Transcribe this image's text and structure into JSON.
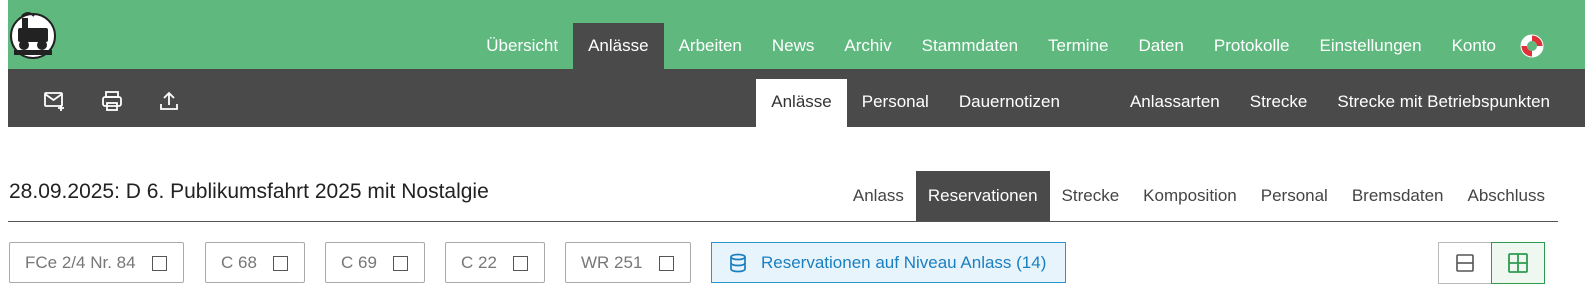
{
  "topnav": {
    "items": [
      "Übersicht",
      "Anlässe",
      "Arbeiten",
      "News",
      "Archiv",
      "Stammdaten",
      "Termine",
      "Daten",
      "Protokolle",
      "Einstellungen",
      "Konto"
    ],
    "active": "Anlässe",
    "help_icon": "lifebuoy-icon"
  },
  "toolbar": {
    "icons": [
      "mail-plus-icon",
      "print-icon",
      "upload-icon"
    ],
    "subnav": {
      "items": [
        "Anlässe",
        "Personal",
        "Dauernotizen",
        "Anlassarten",
        "Strecke",
        "Strecke mit Betriebspunkten"
      ],
      "active": "Anlässe"
    }
  },
  "page": {
    "title": "28.09.2025: D 6. Publikumsfahrt 2025 mit Nostalgie",
    "tabs": [
      "Anlass",
      "Reservationen",
      "Strecke",
      "Komposition",
      "Personal",
      "Bremsdaten",
      "Abschluss"
    ],
    "active_tab": "Reservationen"
  },
  "filters": {
    "vehicles": [
      "FCe 2/4 Nr. 84",
      "C 68",
      "C 69",
      "C 22",
      "WR 251"
    ],
    "reservations_button": "Reservationen auf Niveau Anlass (14)"
  },
  "view_toggle": {
    "options": [
      "single-view-icon",
      "grid-view-icon"
    ],
    "active": "grid-view-icon"
  },
  "colors": {
    "brand_green": "#5fb97f",
    "toolbar_dark": "#4a4a4a",
    "accent_blue": "#1a7fc0"
  }
}
